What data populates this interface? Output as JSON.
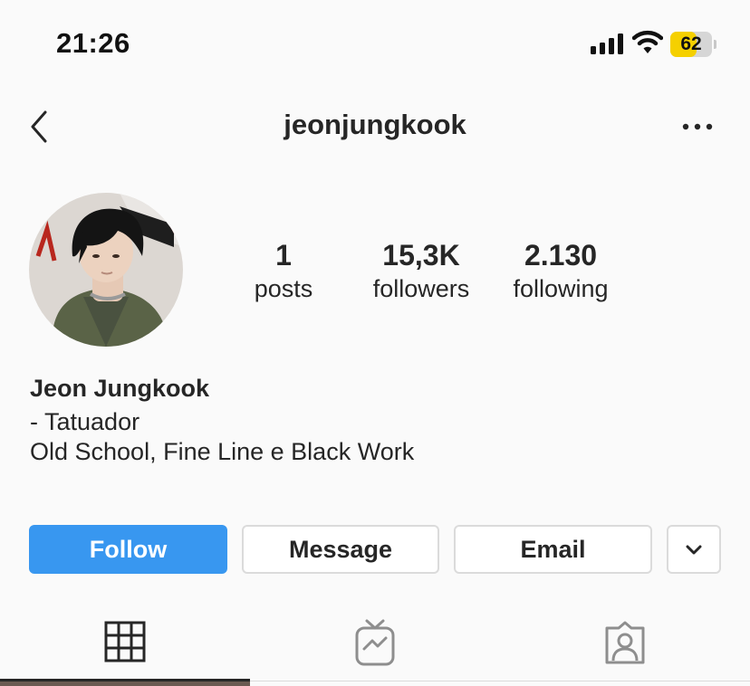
{
  "status_bar": {
    "time": "21:26",
    "signal_icon": "cellular-signal-icon",
    "wifi_icon": "wifi-icon",
    "battery_level": "62",
    "battery_fraction": 0.62,
    "battery_color": "#f5d000"
  },
  "header": {
    "back_icon": "chevron-left-icon",
    "username": "jeonjungkook",
    "more_icon": "more-horizontal-icon"
  },
  "profile": {
    "avatar_icon": "profile-photo",
    "stats": {
      "posts_count": "1",
      "posts_label": "posts",
      "followers_count": "15,3K",
      "followers_label": "followers",
      "following_count": "2.130",
      "following_label": "following"
    },
    "bio": {
      "name": "Jeon Jungkook",
      "line1": "- Tatuador",
      "line2": "Old School, Fine Line e Black Work"
    }
  },
  "actions": {
    "follow_label": "Follow",
    "message_label": "Message",
    "email_label": "Email",
    "more_icon": "chevron-down-icon",
    "accent_color": "#3897f0"
  },
  "tabs": [
    {
      "icon": "grid-icon",
      "active": true
    },
    {
      "icon": "igtv-icon",
      "active": false
    },
    {
      "icon": "tagged-user-icon",
      "active": false
    }
  ]
}
